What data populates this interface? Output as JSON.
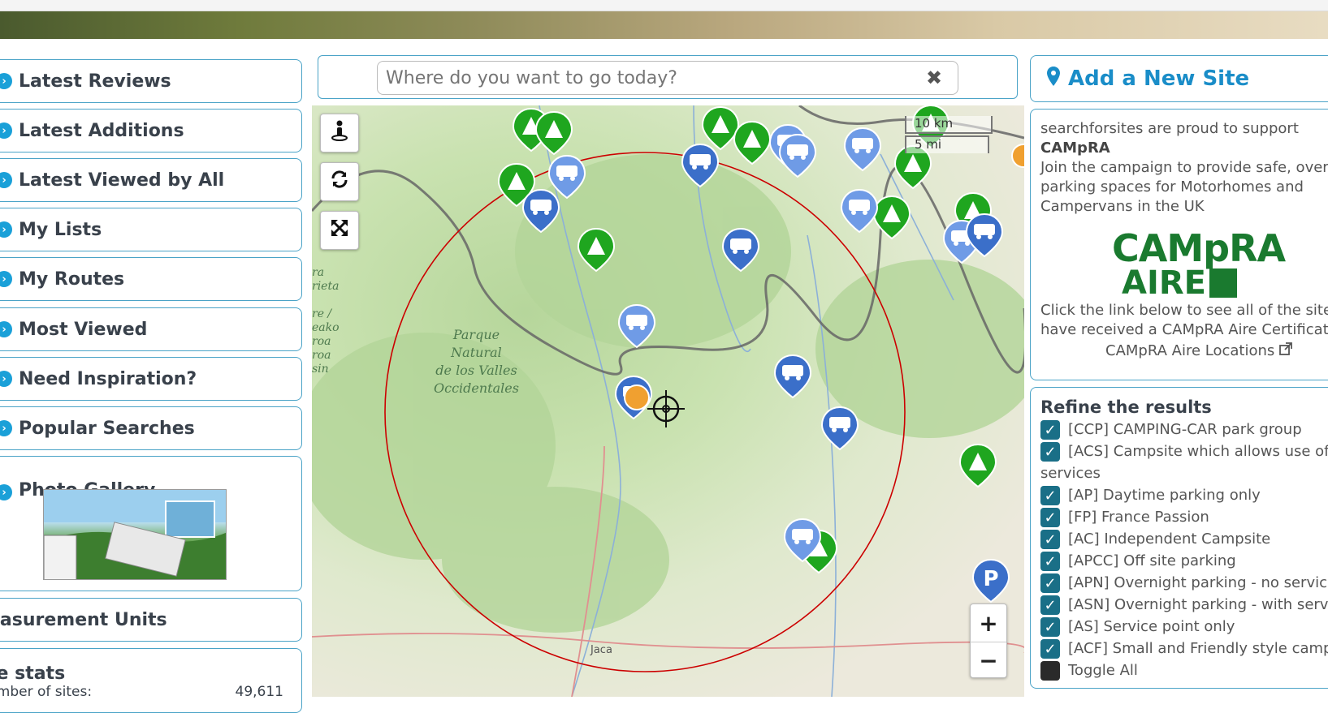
{
  "sidebar": {
    "items": [
      {
        "label": "Latest Reviews"
      },
      {
        "label": "Latest Additions"
      },
      {
        "label": "Latest Viewed by All"
      },
      {
        "label": "My Lists"
      },
      {
        "label": "My Routes"
      },
      {
        "label": "Most Viewed"
      },
      {
        "label": "Need Inspiration?"
      },
      {
        "label": "Popular Searches"
      },
      {
        "label": "Photo Gallery"
      }
    ],
    "units_label": "easurement Units",
    "stats_title": "te stats",
    "stats_row_label": "umber of sites:",
    "stats_row_value": "49,611"
  },
  "search": {
    "placeholder": "Where do you want to go today?",
    "clear": "✖"
  },
  "map": {
    "scale_km": "10 km",
    "scale_mi": "5 mi",
    "park_label": "Parque\nNatural\nde los Valles\nOccidentales",
    "town_jaca": "Jaca",
    "edge_label": "ra\nrieta\n\nre /\neako\nroa\nroa\nsin",
    "zoom_in": "+",
    "zoom_out": "−",
    "colors": {
      "camp": "#1fa61f",
      "motorhome": "#3b6fc9",
      "motorhome_light": "#6f9be6",
      "circle": "#cc0000"
    }
  },
  "right": {
    "add_site": "Add a New Site",
    "promo": {
      "line1": "searchforsites are proud to support",
      "campra": "CAMpRA",
      "line2": "Join the campaign to provide safe, overn",
      "line3": "parking spaces for Motorhomes and",
      "line4": "Campervans in the UK",
      "logo_top": "CAMpRA",
      "logo_bottom": "AIRE",
      "line5": "Click the link below to see all of the sites",
      "line6": "have received a CAMpRA Aire Certificate",
      "link": "CAMpRA Aire Locations"
    },
    "refine": {
      "title": "Refine the results",
      "options": [
        {
          "label": "[CCP] CAMPING-CAR park group",
          "checked": true
        },
        {
          "label": "[ACS] Campsite which allows use of services",
          "checked": true
        },
        {
          "label": "[AP] Daytime parking only",
          "checked": true
        },
        {
          "label": "[FP] France Passion",
          "checked": true
        },
        {
          "label": "[AC] Independent Campsite",
          "checked": true
        },
        {
          "label": "[APCC] Off site parking",
          "checked": true
        },
        {
          "label": "[APN] Overnight parking - no services",
          "checked": true
        },
        {
          "label": "[ASN] Overnight parking - with service",
          "checked": true
        },
        {
          "label": "[AS] Service point only",
          "checked": true
        },
        {
          "label": "[ACF] Small and Friendly style campsi",
          "checked": true
        },
        {
          "label": "Toggle All",
          "checked": false
        }
      ]
    }
  }
}
